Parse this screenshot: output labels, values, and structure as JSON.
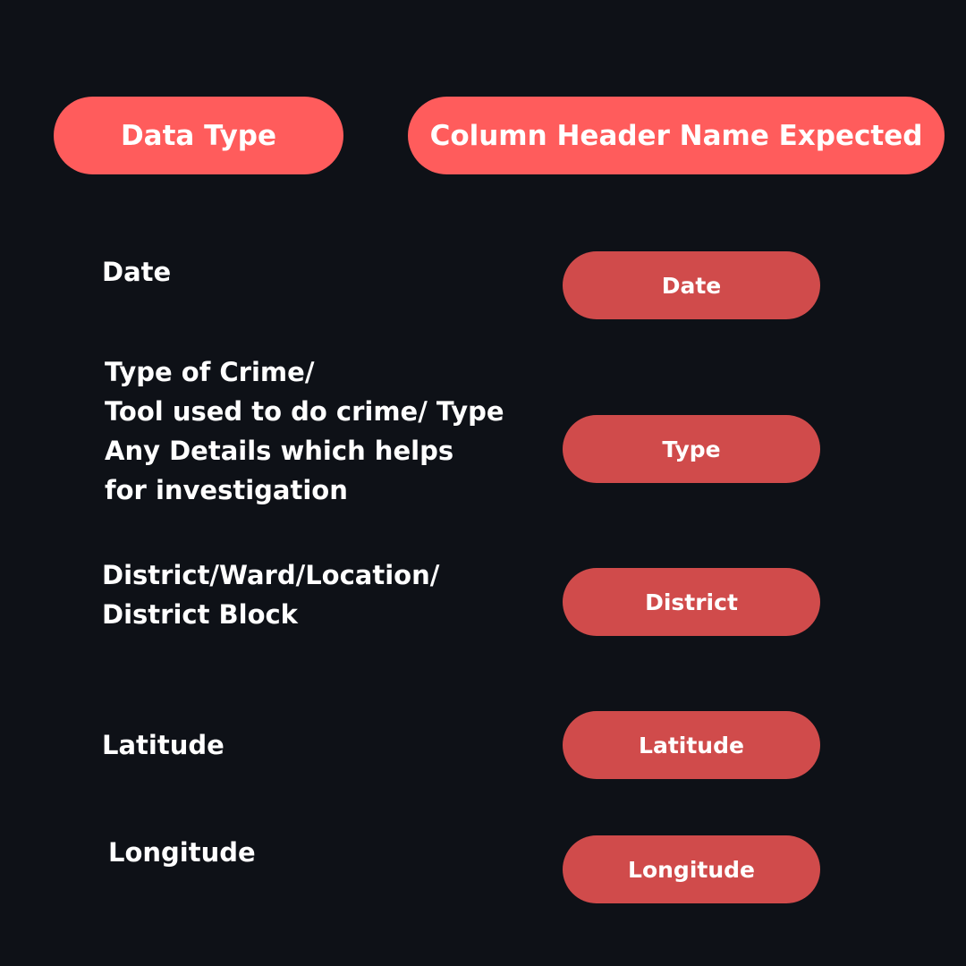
{
  "headers": {
    "data_type": "Data Type",
    "column_header": "Column Header Name Expected"
  },
  "rows": [
    {
      "label_lines": [
        "Date"
      ],
      "column_name": "Date"
    },
    {
      "label_lines": [
        "Type of Crime/",
        "Tool used to do crime/ Type",
        "Any Details which helps",
        "for investigation"
      ],
      "column_name": "Type"
    },
    {
      "label_lines": [
        "District/Ward/Location/",
        "District Block"
      ],
      "column_name": "District"
    },
    {
      "label_lines": [
        "Latitude"
      ],
      "column_name": "Latitude"
    },
    {
      "label_lines": [
        "Longitude"
      ],
      "column_name": "Longitude"
    }
  ],
  "colors": {
    "background": "#0e1117",
    "header_pill": "#ff5c5c",
    "column_pill": "#d04b4b",
    "text": "#ffffff"
  }
}
